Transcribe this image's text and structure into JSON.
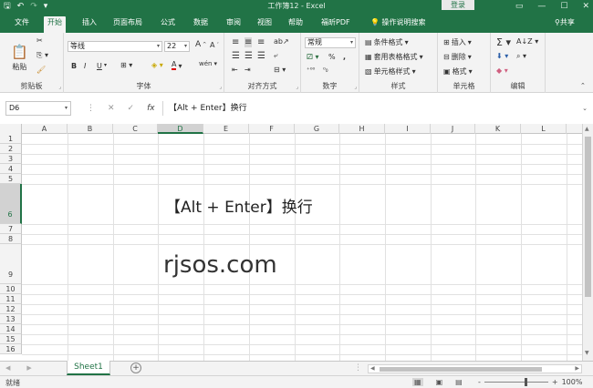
{
  "title_bar": {
    "document_title": "工作簿12 - Excel",
    "login_label": "登录",
    "qat": [
      "save-icon",
      "undo-icon",
      "redo-icon",
      "customize-icon"
    ]
  },
  "tabs": [
    "文件",
    "开始",
    "插入",
    "页面布局",
    "公式",
    "数据",
    "审阅",
    "视图",
    "帮助",
    "福昕PDF",
    "操作说明搜索"
  ],
  "active_tab": "开始",
  "share_label": "共享",
  "ribbon": {
    "clipboard": {
      "paste": "粘贴",
      "label": "剪贴板"
    },
    "font": {
      "name": "等线",
      "size": "22",
      "grow": "A",
      "shrink": "A",
      "bold": "B",
      "italic": "I",
      "underline": "U",
      "font_color": "A",
      "phonetic": "wén",
      "label": "字体"
    },
    "alignment": {
      "label": "对齐方式"
    },
    "number": {
      "format": "常规",
      "percent": "%",
      "comma": ",",
      "label": "数字"
    },
    "styles": {
      "conditional": "条件格式",
      "table": "套用表格格式",
      "cell_styles": "单元格样式",
      "label": "样式"
    },
    "cells": {
      "insert": "插入",
      "delete": "删除",
      "format": "格式",
      "label": "单元格"
    },
    "editing": {
      "label": "编辑"
    }
  },
  "formula_bar": {
    "name_box": "D6",
    "formula": "【Alt + Enter】换行",
    "fx": "fx"
  },
  "columns": [
    "A",
    "B",
    "C",
    "D",
    "E",
    "F",
    "G",
    "H",
    "I",
    "J",
    "K",
    "L"
  ],
  "rows": [
    "1",
    "2",
    "3",
    "4",
    "5",
    "6",
    "7",
    "8",
    "9",
    "10",
    "11",
    "12",
    "13",
    "14",
    "15",
    "16"
  ],
  "cells": {
    "D6": "【Alt + Enter】换行",
    "D9": "rjsos.com"
  },
  "sheets": [
    "Sheet1"
  ],
  "status": {
    "ready": "就绪",
    "zoom": "100%",
    "zoom_out": "-",
    "zoom_in": "+"
  }
}
